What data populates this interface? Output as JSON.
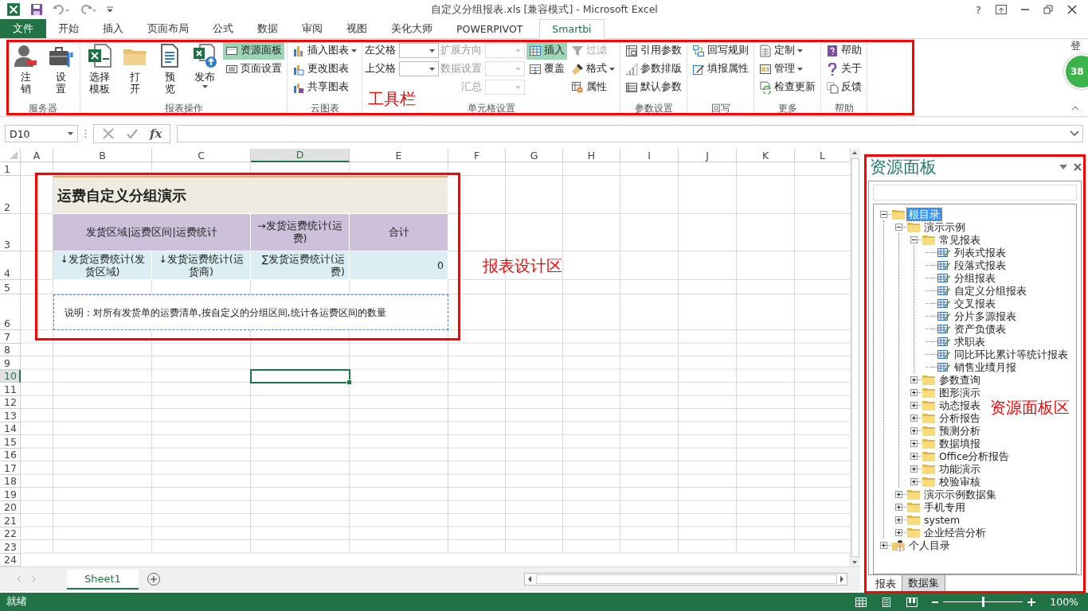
{
  "window": {
    "title": "自定义分组报表.xls  [兼容模式] - Microsoft Excel",
    "help": "?"
  },
  "ribbon_tabs": [
    {
      "label": "文件",
      "kind": "file",
      "selected": false
    },
    {
      "label": "开始",
      "kind": "tab",
      "selected": false
    },
    {
      "label": "插入",
      "kind": "tab",
      "selected": false
    },
    {
      "label": "页面布局",
      "kind": "tab",
      "selected": false
    },
    {
      "label": "公式",
      "kind": "tab",
      "selected": false
    },
    {
      "label": "数据",
      "kind": "tab",
      "selected": false
    },
    {
      "label": "审阅",
      "kind": "tab",
      "selected": false
    },
    {
      "label": "视图",
      "kind": "tab",
      "selected": false
    },
    {
      "label": "美化大师",
      "kind": "tab",
      "selected": false
    },
    {
      "label": "POWERPIVOT",
      "kind": "tab",
      "selected": false
    },
    {
      "label": "Smartbi",
      "kind": "tab",
      "selected": true
    }
  ],
  "account": {
    "label": "登",
    "badge": "38"
  },
  "ribbon_groups": [
    {
      "title": "服务器",
      "columns": [
        [
          {
            "kind": "large",
            "label": "注销"
          }
        ],
        [
          {
            "kind": "large",
            "label": "设置"
          }
        ]
      ]
    },
    {
      "title": "报表操作",
      "columns": [
        [
          {
            "kind": "large",
            "label": "选择模板"
          }
        ],
        [
          {
            "kind": "large",
            "label": "打开"
          }
        ],
        [
          {
            "kind": "large",
            "label": "预览"
          }
        ],
        [
          {
            "kind": "large",
            "label": "发布",
            "dropdown": true
          }
        ],
        [
          {
            "kind": "small",
            "label": "资源面板",
            "selected": true
          },
          {
            "kind": "small",
            "label": "页面设置",
            "selected": false
          }
        ]
      ]
    },
    {
      "title": "云图表",
      "columns": [
        [
          {
            "kind": "small",
            "label": "插入图表",
            "dropdown": true
          },
          {
            "kind": "small",
            "label": "更改图表"
          },
          {
            "kind": "small",
            "label": "共享图表"
          }
        ]
      ]
    },
    {
      "title": "单元格设置",
      "columns": [
        [
          {
            "kind": "combo",
            "label": "左父格",
            "disabled": false
          },
          {
            "kind": "combo",
            "label": "上父格",
            "disabled": false
          }
        ],
        [
          {
            "kind": "combo",
            "label": "扩展方向",
            "disabled": true
          },
          {
            "kind": "combo",
            "label": "数据设置",
            "disabled": true
          },
          {
            "kind": "combo",
            "label": "汇总",
            "disabled": true
          }
        ],
        [
          {
            "kind": "small",
            "label": "插入",
            "selected": true
          },
          {
            "kind": "small",
            "label": "覆盖",
            "selected": false
          }
        ],
        [
          {
            "kind": "small",
            "label": "过滤",
            "disabled": true
          },
          {
            "kind": "small",
            "label": "格式",
            "dropdown": true,
            "disabled": false
          },
          {
            "kind": "small",
            "label": "属性",
            "disabled": false
          }
        ]
      ]
    },
    {
      "title": "参数设置",
      "columns": [
        [
          {
            "kind": "small",
            "label": "引用参数"
          },
          {
            "kind": "small",
            "label": "参数排版"
          },
          {
            "kind": "small",
            "label": "默认参数"
          }
        ]
      ]
    },
    {
      "title": "回写",
      "columns": [
        [
          {
            "kind": "small",
            "label": "回写规则"
          },
          {
            "kind": "small",
            "label": "填报属性"
          }
        ]
      ]
    },
    {
      "title": "更多",
      "columns": [
        [
          {
            "kind": "small",
            "label": "定制",
            "dropdown": true
          },
          {
            "kind": "small",
            "label": "管理",
            "dropdown": true
          },
          {
            "kind": "small",
            "label": "检查更新"
          }
        ]
      ]
    },
    {
      "title": "帮助",
      "columns": [
        [
          {
            "kind": "small",
            "label": "帮助"
          },
          {
            "kind": "small",
            "label": "关于"
          },
          {
            "kind": "small",
            "label": "反馈"
          }
        ]
      ]
    }
  ],
  "formula_bar": {
    "name_box": "D10",
    "function_button": "fx"
  },
  "sheet": {
    "columns": [
      {
        "label": "A",
        "selected": false
      },
      {
        "label": "B",
        "selected": false
      },
      {
        "label": "C",
        "selected": false
      },
      {
        "label": "D",
        "selected": true
      },
      {
        "label": "E",
        "selected": false
      },
      {
        "label": "F",
        "selected": false
      },
      {
        "label": "G",
        "selected": false
      },
      {
        "label": "H",
        "selected": false
      },
      {
        "label": "I",
        "selected": false
      },
      {
        "label": "J",
        "selected": false
      },
      {
        "label": "K",
        "selected": false
      },
      {
        "label": "L",
        "selected": false
      }
    ],
    "rows": [
      {
        "label": "1",
        "selected": false
      },
      {
        "label": "2",
        "selected": false
      },
      {
        "label": "3",
        "selected": false
      },
      {
        "label": "4",
        "selected": false
      },
      {
        "label": "5",
        "selected": false
      },
      {
        "label": "6",
        "selected": false
      },
      {
        "label": "7",
        "selected": false
      },
      {
        "label": "8",
        "selected": false
      },
      {
        "label": "9",
        "selected": false
      },
      {
        "label": "10",
        "selected": true
      },
      {
        "label": "11",
        "selected": false
      },
      {
        "label": "12",
        "selected": false
      },
      {
        "label": "13",
        "selected": false
      },
      {
        "label": "14",
        "selected": false
      },
      {
        "label": "15",
        "selected": false
      },
      {
        "label": "16",
        "selected": false
      },
      {
        "label": "17",
        "selected": false
      },
      {
        "label": "18",
        "selected": false
      },
      {
        "label": "19",
        "selected": false
      },
      {
        "label": "20",
        "selected": false
      },
      {
        "label": "21",
        "selected": false
      },
      {
        "label": "22",
        "selected": false
      },
      {
        "label": "23",
        "selected": false
      },
      {
        "label": "24",
        "selected": false
      }
    ],
    "cells": [
      {
        "kind": "title",
        "text": "运费自定义分组演示"
      },
      {
        "kind": "header",
        "text": "发货区域|运费区间|运费统计"
      },
      {
        "kind": "header",
        "text": "→发货运费统计(运费)"
      },
      {
        "kind": "header",
        "text": "合计"
      },
      {
        "kind": "data",
        "text": "↓发货运费统计(发货区域)"
      },
      {
        "kind": "data",
        "text": "↓发货运费统计(运货商)"
      },
      {
        "kind": "data",
        "text": "∑发货运费统计(运费)"
      },
      {
        "kind": "data",
        "text": "0"
      },
      {
        "kind": "note",
        "text": "说明：对所有发货单的运费清单,按自定义的分组区间,统计各运费区间的数量"
      }
    ],
    "sheet_tabs": [
      {
        "label": "Sheet1",
        "selected": true
      }
    ]
  },
  "resource_panel": {
    "title": "资源面板",
    "tree": [
      {
        "label": "根目录",
        "kind": "folder",
        "expanded": true,
        "selected": true,
        "children": [
          {
            "label": "演示示例",
            "kind": "folder",
            "expanded": true,
            "selected": false,
            "children": [
              {
                "label": "常见报表",
                "kind": "folder",
                "expanded": true,
                "selected": false,
                "children": [
                  {
                    "label": "列表式报表",
                    "kind": "report",
                    "selected": false
                  },
                  {
                    "label": "段落式报表",
                    "kind": "report",
                    "selected": false
                  },
                  {
                    "label": "分组报表",
                    "kind": "report",
                    "selected": false
                  },
                  {
                    "label": "自定义分组报表",
                    "kind": "report",
                    "selected": false
                  },
                  {
                    "label": "交叉报表",
                    "kind": "report",
                    "selected": false
                  },
                  {
                    "label": "分片多源报表",
                    "kind": "report",
                    "selected": false
                  },
                  {
                    "label": "资产负债表",
                    "kind": "report",
                    "selected": false
                  },
                  {
                    "label": "求职表",
                    "kind": "report",
                    "selected": false
                  },
                  {
                    "label": "同比环比累计等统计报表",
                    "kind": "report",
                    "selected": false
                  },
                  {
                    "label": "销售业绩月报",
                    "kind": "report",
                    "selected": false
                  }
                ]
              },
              {
                "label": "参数查询",
                "kind": "folder",
                "expanded": false,
                "selected": false
              },
              {
                "label": "图形演示",
                "kind": "folder",
                "expanded": false,
                "selected": false
              },
              {
                "label": "动态报表",
                "kind": "folder",
                "expanded": false,
                "selected": false
              },
              {
                "label": "分析报告",
                "kind": "folder",
                "expanded": false,
                "selected": false
              },
              {
                "label": "预测分析",
                "kind": "folder",
                "expanded": false,
                "selected": false
              },
              {
                "label": "数据填报",
                "kind": "folder",
                "expanded": false,
                "selected": false
              },
              {
                "label": "Office分析报告",
                "kind": "folder",
                "expanded": false,
                "selected": false
              },
              {
                "label": "功能演示",
                "kind": "folder",
                "expanded": false,
                "selected": false
              },
              {
                "label": "校验审核",
                "kind": "folder",
                "expanded": false,
                "selected": false
              }
            ]
          },
          {
            "label": "演示示例数据集",
            "kind": "folder",
            "expanded": false,
            "selected": false
          },
          {
            "label": "手机专用",
            "kind": "folder",
            "expanded": false,
            "selected": false
          },
          {
            "label": "system",
            "kind": "folder",
            "expanded": false,
            "selected": false
          },
          {
            "label": "企业经营分析",
            "kind": "folder",
            "expanded": false,
            "selected": false
          }
        ]
      },
      {
        "label": "个人目录",
        "kind": "user",
        "expanded": false,
        "selected": false
      }
    ],
    "tabs": [
      {
        "label": "报表",
        "selected": true
      },
      {
        "label": "数据集",
        "selected": false
      }
    ]
  },
  "status_bar": {
    "status": "就绪",
    "zoom": "100%",
    "level": 0.5
  },
  "annotations": [
    {
      "text": "工具栏"
    },
    {
      "text": "报表设计区"
    },
    {
      "text": "资源面板区"
    }
  ]
}
